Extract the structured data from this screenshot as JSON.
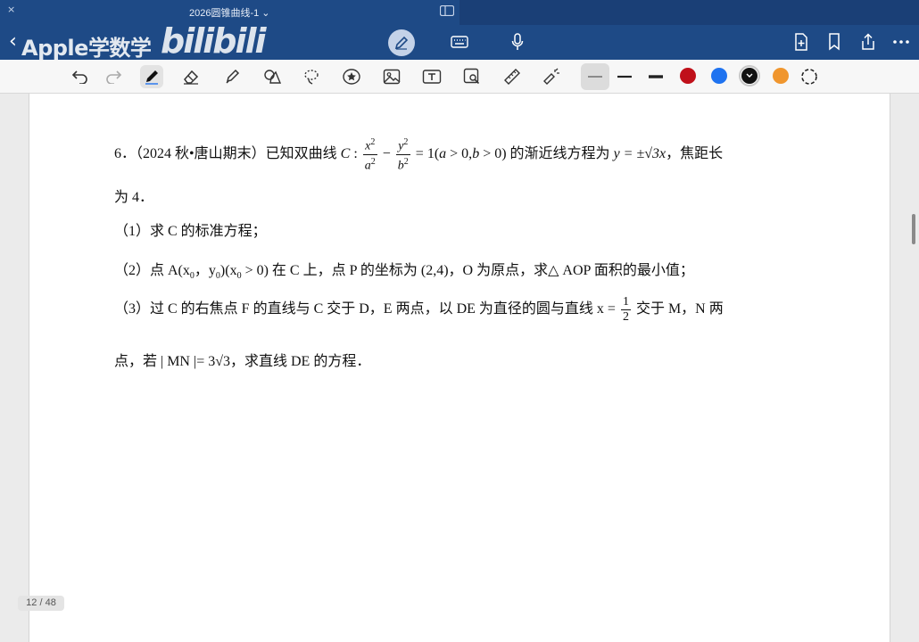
{
  "window": {
    "close_glyph": "×",
    "title": "2026圆锥曲线-1 ⌄"
  },
  "header": {
    "back_glyph": "‹",
    "brand_text": "Apple学数学",
    "bili_text": "bilibili"
  },
  "colors": {
    "swatches": [
      "#c0101a",
      "#1f73f0",
      "#111111",
      "#f0962e"
    ]
  },
  "problem": {
    "number": "6．",
    "source": "（2024 秋•唐山期末）",
    "l1_a": "已知双曲线",
    "hyperbola_label": "C",
    "l1_b": "的渐近线方程为",
    "asymptote": "y = ±√3x",
    "l1_c": "，焦距长",
    "l2": "为 4．",
    "q1": "（1）求 C 的标准方程；",
    "q2_a": "（2）点 A(x",
    "q2_b": "，y",
    "q2_c": ")(x",
    "q2_d": "> 0) 在 C 上，点 P 的坐标为 (2,4)，O 为原点，求△ AOP 面积的最小值；",
    "q3_a": "（3）过 C 的右焦点 F 的直线与 C 交于 D，E 两点，以 DE 为直径的圆与直线 x =",
    "q3_b": "交于 M，N 两",
    "q3_c": "点，若 | MN |= 3√3，求直线 DE 的方程．"
  },
  "page_indicator": "12 / 48"
}
